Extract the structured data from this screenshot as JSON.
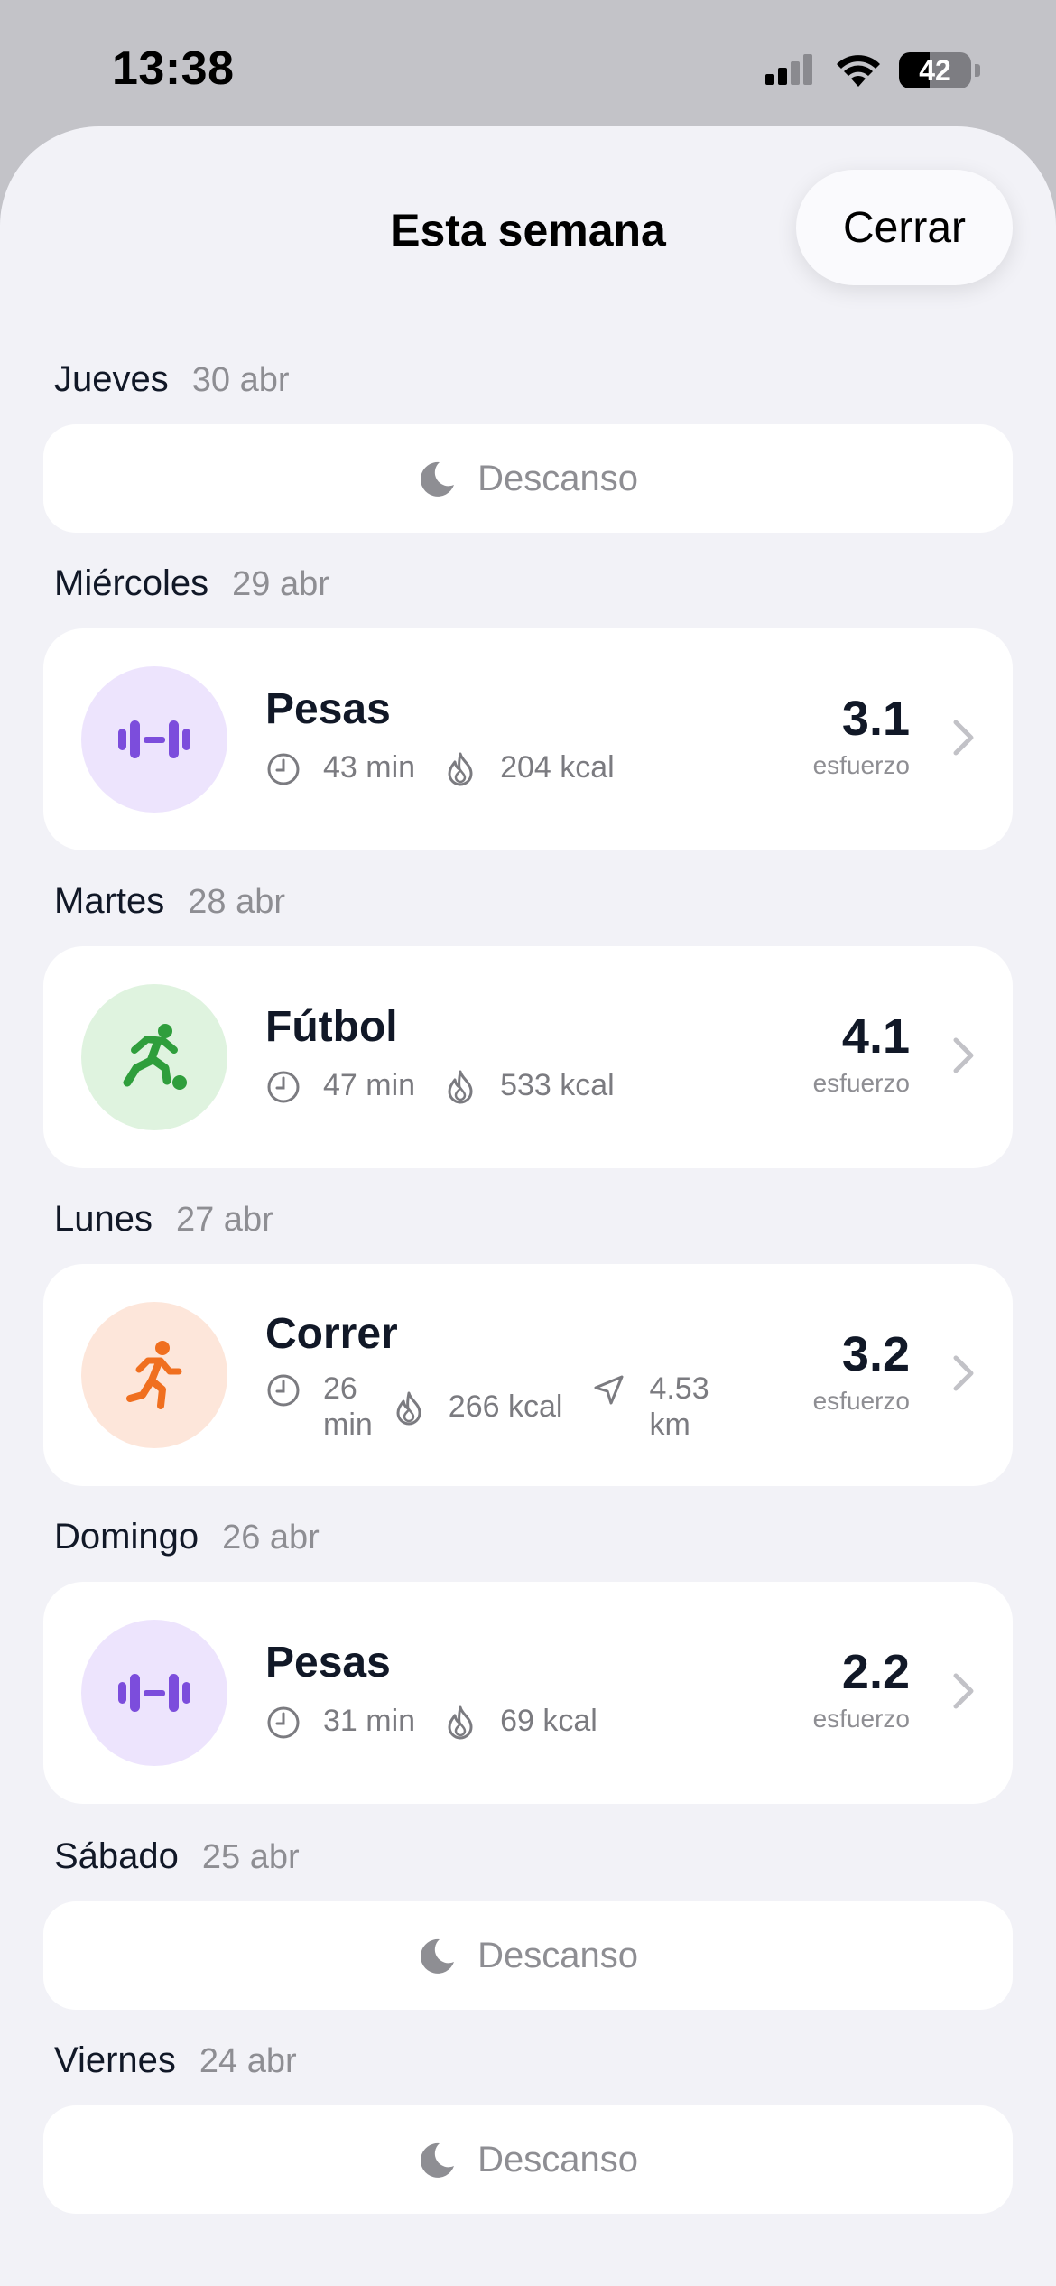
{
  "status_bar": {
    "time": "13:38",
    "battery": "42",
    "battery_level": 0.42
  },
  "sheet": {
    "title": "Esta semana",
    "close_label": "Cerrar"
  },
  "colors": {
    "weights_bg": "#ede4fd",
    "weights_icon": "#7c4ddc",
    "football_bg": "#dff3df",
    "football_icon": "#2f9e3c",
    "running_bg": "#fde6da",
    "running_icon": "#f06f1f"
  },
  "days": [
    {
      "day": "Jueves",
      "date": "30 abr",
      "rest": "Descanso"
    },
    {
      "day": "Miércoles",
      "date": "29 abr",
      "workout": {
        "name": "Pesas",
        "icon": "dumbbell-icon",
        "duration": "43 min",
        "calories": "204 kcal",
        "effort": "3.1",
        "effort_label": "esfuerzo"
      }
    },
    {
      "day": "Martes",
      "date": "28 abr",
      "workout": {
        "name": "Fútbol",
        "icon": "football-player-icon",
        "duration": "47 min",
        "calories": "533 kcal",
        "effort": "4.1",
        "effort_label": "esfuerzo"
      }
    },
    {
      "day": "Lunes",
      "date": "27 abr",
      "workout": {
        "name": "Correr",
        "icon": "runner-icon",
        "duration_num": "26",
        "duration_unit": "min",
        "calories": "266 kcal",
        "distance_num": "4.53",
        "distance_unit": "km",
        "effort": "3.2",
        "effort_label": "esfuerzo"
      }
    },
    {
      "day": "Domingo",
      "date": "26 abr",
      "workout": {
        "name": "Pesas",
        "icon": "dumbbell-icon",
        "duration": "31 min",
        "calories": "69 kcal",
        "effort": "2.2",
        "effort_label": "esfuerzo"
      }
    },
    {
      "day": "Sábado",
      "date": "25 abr",
      "rest": "Descanso"
    },
    {
      "day": "Viernes",
      "date": "24 abr",
      "rest": "Descanso"
    }
  ]
}
